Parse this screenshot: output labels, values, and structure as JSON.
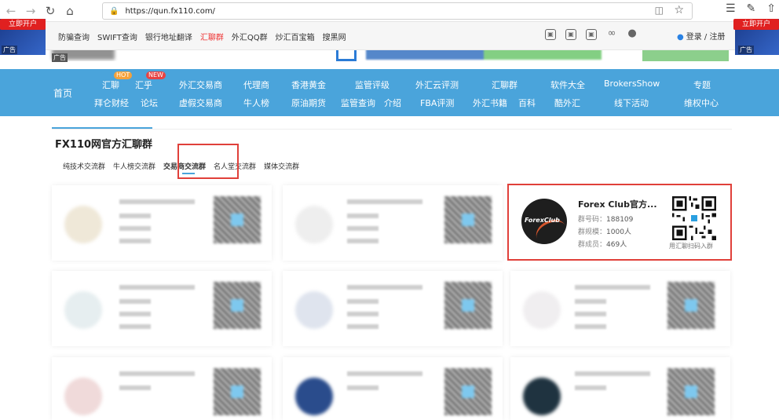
{
  "browser": {
    "url": "https://qun.fx110.com/"
  },
  "topbar": {
    "links": [
      "防骗查询",
      "SWIFT查询",
      "银行地址翻译",
      "汇聊群",
      "外汇QQ群",
      "炒汇百宝箱",
      "搜黑网"
    ],
    "login_label": "登录 / 注册"
  },
  "ads": {
    "left_button": "立即开户",
    "right_button": "立即开户",
    "tag": "广告"
  },
  "mainnav": {
    "home": "首页",
    "items": [
      {
        "label": "汇聊"
      },
      {
        "label": "汇乎"
      },
      {
        "label": "外汇交易商"
      },
      {
        "label": "代理商"
      },
      {
        "label": "香港黄金"
      },
      {
        "label": "监管评级"
      },
      {
        "label": "外汇云评测"
      },
      {
        "label": "汇聊群"
      },
      {
        "label": "软件大全"
      },
      {
        "label": "BrokersShow"
      },
      {
        "label": "专题"
      },
      {
        "label": "拜仑财经"
      },
      {
        "label": "论坛"
      },
      {
        "label": "虚假交易商"
      },
      {
        "label": "牛人榜"
      },
      {
        "label": "原油期货"
      },
      {
        "label": "监管查询"
      },
      {
        "label": "介绍"
      },
      {
        "label": "FBA评测"
      },
      {
        "label": "外汇书籍"
      },
      {
        "label": "百科"
      },
      {
        "label": "酷外汇"
      },
      {
        "label": "线下活动"
      },
      {
        "label": "维权中心"
      }
    ],
    "badge_hot": "HOT",
    "badge_new": "NEW"
  },
  "section": {
    "title": "FX110网官方汇聊群",
    "tabs": [
      "纯技术交流群",
      "牛人榜交流群",
      "交易商交流群",
      "名人堂交流群",
      "媒体交流群"
    ],
    "active_tab": "交易商交流群"
  },
  "featured_group": {
    "name": "Forex Club官方...",
    "logo_text": "ForexClub",
    "group_id_label": "群号码：",
    "group_id": "188109",
    "scale_label": "群规模：",
    "scale": "1000人",
    "members_label": "群成员：",
    "members": "469人",
    "scan_hint": "用汇聊扫码入群"
  },
  "colors": {
    "nav_blue": "#4aa4db",
    "highlight_red": "#e0403a",
    "forex_orange": "#d4552c"
  }
}
